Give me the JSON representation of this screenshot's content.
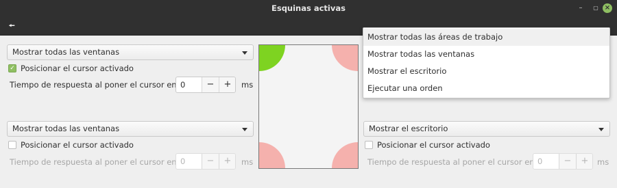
{
  "window": {
    "title": "Esquinas activas"
  },
  "options": [
    "Mostrar todas las áreas de trabajo",
    "Mostrar todas las ventanas",
    "Mostrar el escritorio",
    "Ejecutar una orden"
  ],
  "corners": {
    "top_left": {
      "action": "Mostrar todas las ventanas",
      "cursor_label": "Posicionar el cursor activado",
      "cursor_checked": true,
      "delay_label": "Tiempo de respuesta al poner el cursor encima",
      "delay_value": "0",
      "unit": "ms"
    },
    "top_right": {
      "action": "Mostrar todas las áreas de trabajo"
    },
    "bottom_left": {
      "action": "Mostrar todas las ventanas",
      "cursor_label": "Posicionar el cursor activado",
      "cursor_checked": false,
      "delay_label": "Tiempo de respuesta al poner el cursor encima",
      "delay_value": "0",
      "unit": "ms"
    },
    "bottom_right": {
      "action": "Mostrar el escritorio",
      "cursor_label": "Posicionar el cursor activado",
      "cursor_checked": false,
      "delay_label": "Tiempo de respuesta al poner el cursor encima",
      "delay_value": "0",
      "unit": "ms"
    }
  },
  "preview_colors": {
    "active": "#7ed321",
    "inactive": "#f5b1ad"
  },
  "icons": {
    "back": "back-arrow-icon",
    "minimize": "minimize-icon",
    "maximize": "maximize-icon",
    "close": "close-icon"
  },
  "spin_labels": {
    "minus": "−",
    "plus": "+"
  }
}
